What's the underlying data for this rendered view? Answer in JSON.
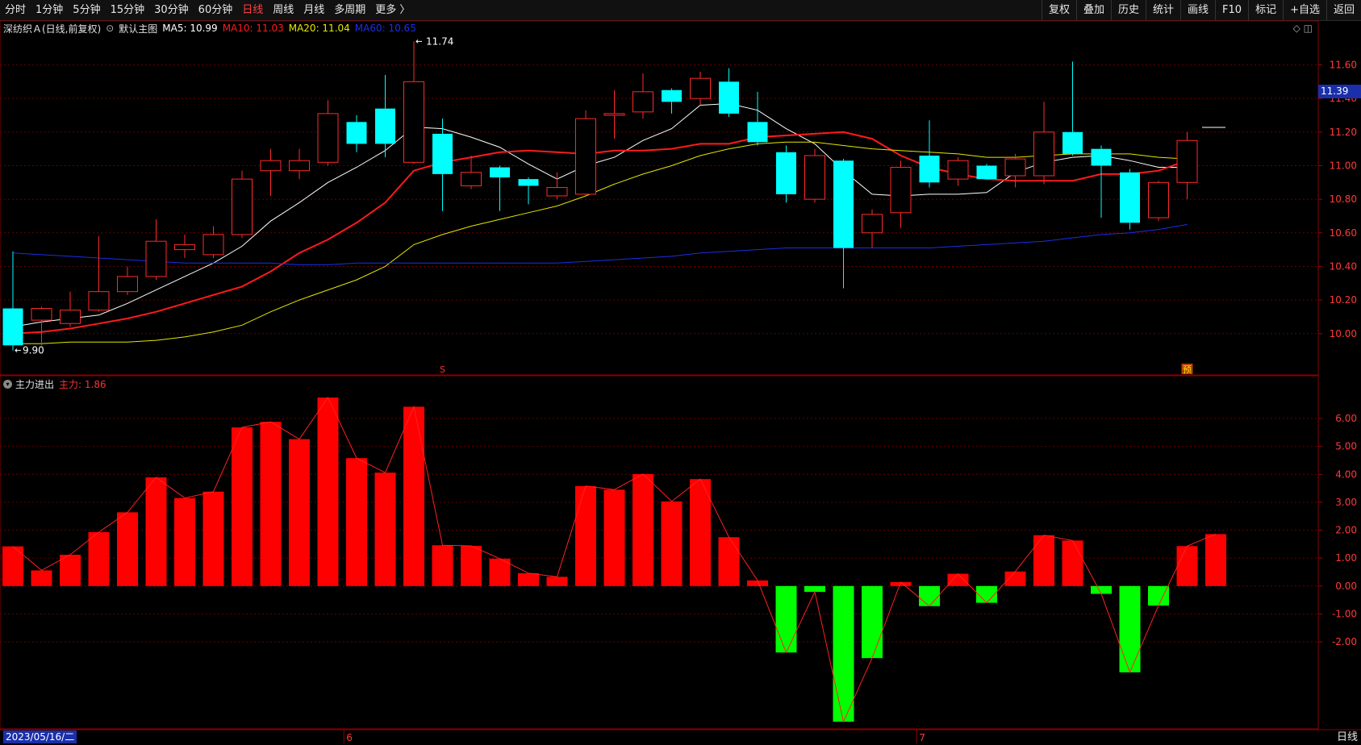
{
  "toolbar": {
    "period_tabs": [
      "分时",
      "1分钟",
      "5分钟",
      "15分钟",
      "30分钟",
      "60分钟",
      "日线",
      "周线",
      "月线",
      "多周期",
      "更多 〉"
    ],
    "active_tab": "日线",
    "right_buttons": [
      "复权",
      "叠加",
      "历史",
      "统计",
      "画线",
      "F10",
      "标记",
      "+自选",
      "返回"
    ]
  },
  "legend": {
    "stock": "深纺织Ａ(日线,前复权)",
    "main_chart": "默认主图",
    "ma5": "MA5: 10.99",
    "ma10": "MA10: 11.03",
    "ma20": "MA20: 11.04",
    "ma60": "MA60: 10.65"
  },
  "indicator": {
    "name": "主力进出",
    "value": "主力: 1.86"
  },
  "current_price_tag": "11.39",
  "date_badge": "2023/05/16/二",
  "period_label": "日线",
  "month_labels": [
    {
      "text": "6",
      "index": 12
    },
    {
      "text": "7",
      "index": 32
    }
  ],
  "markers": [
    {
      "text": "S",
      "index": 15
    },
    {
      "text": "预",
      "index": 41
    }
  ],
  "colors": {
    "up": "#ff2a2a",
    "down": "#00ffff",
    "ma5": "#ffffff",
    "ma10": "#ff1a1a",
    "ma20": "#e6e600",
    "ma60": "#1a2fe6",
    "pos_bar": "#ff0000",
    "neg_bar": "#00ff00",
    "grid": "#6a0000"
  },
  "chart_data": [
    {
      "type": "candlestick",
      "y_ticks": [
        "11.60",
        "11.40",
        "11.20",
        "11.00",
        "10.80",
        "10.60",
        "10.40",
        "10.20",
        "10.00"
      ],
      "ylim": [
        9.85,
        11.78
      ],
      "annotations": [
        {
          "text": "11.74",
          "index": 14
        },
        {
          "text": "9.90",
          "index": 0
        }
      ],
      "candles": [
        {
          "o": 10.15,
          "c": 9.93,
          "h": 10.49,
          "l": 9.9
        },
        {
          "o": 10.08,
          "c": 10.15,
          "h": 10.16,
          "l": 9.93
        },
        {
          "o": 10.06,
          "c": 10.14,
          "h": 10.25,
          "l": 10.04
        },
        {
          "o": 10.14,
          "c": 10.25,
          "h": 10.58,
          "l": 10.13
        },
        {
          "o": 10.25,
          "c": 10.34,
          "h": 10.4,
          "l": 10.23
        },
        {
          "o": 10.34,
          "c": 10.55,
          "h": 10.68,
          "l": 10.32
        },
        {
          "o": 10.5,
          "c": 10.53,
          "h": 10.59,
          "l": 10.45
        },
        {
          "o": 10.47,
          "c": 10.59,
          "h": 10.64,
          "l": 10.45
        },
        {
          "o": 10.59,
          "c": 10.92,
          "h": 10.97,
          "l": 10.57
        },
        {
          "o": 10.97,
          "c": 11.03,
          "h": 11.1,
          "l": 10.82
        },
        {
          "o": 10.97,
          "c": 11.03,
          "h": 11.1,
          "l": 10.92
        },
        {
          "o": 11.02,
          "c": 11.31,
          "h": 11.39,
          "l": 11.0
        },
        {
          "o": 11.26,
          "c": 11.13,
          "h": 11.3,
          "l": 11.08
        },
        {
          "o": 11.34,
          "c": 11.13,
          "h": 11.54,
          "l": 11.05
        },
        {
          "o": 11.02,
          "c": 11.5,
          "h": 11.74,
          "l": 11.01
        },
        {
          "o": 11.19,
          "c": 10.95,
          "h": 11.28,
          "l": 10.73
        },
        {
          "o": 10.88,
          "c": 10.96,
          "h": 11.06,
          "l": 10.86
        },
        {
          "o": 10.99,
          "c": 10.93,
          "h": 11.0,
          "l": 10.73
        },
        {
          "o": 10.92,
          "c": 10.88,
          "h": 10.93,
          "l": 10.77
        },
        {
          "o": 10.82,
          "c": 10.87,
          "h": 10.96,
          "l": 10.8
        },
        {
          "o": 10.83,
          "c": 11.28,
          "h": 11.33,
          "l": 10.82
        },
        {
          "o": 11.3,
          "c": 11.31,
          "h": 11.45,
          "l": 11.16
        },
        {
          "o": 11.32,
          "c": 11.44,
          "h": 11.55,
          "l": 11.28
        },
        {
          "o": 11.45,
          "c": 11.38,
          "h": 11.46,
          "l": 11.31
        },
        {
          "o": 11.4,
          "c": 11.52,
          "h": 11.56,
          "l": 11.36
        },
        {
          "o": 11.5,
          "c": 11.31,
          "h": 11.58,
          "l": 11.29
        },
        {
          "o": 11.26,
          "c": 11.14,
          "h": 11.44,
          "l": 11.12
        },
        {
          "o": 11.08,
          "c": 10.83,
          "h": 11.12,
          "l": 10.78
        },
        {
          "o": 10.8,
          "c": 11.06,
          "h": 11.1,
          "l": 10.78
        },
        {
          "o": 11.03,
          "c": 10.51,
          "h": 11.04,
          "l": 10.27
        },
        {
          "o": 10.6,
          "c": 10.71,
          "h": 10.74,
          "l": 10.51
        },
        {
          "o": 10.72,
          "c": 10.99,
          "h": 11.03,
          "l": 10.63
        },
        {
          "o": 11.06,
          "c": 10.9,
          "h": 11.27,
          "l": 10.87
        },
        {
          "o": 10.92,
          "c": 11.03,
          "h": 11.05,
          "l": 10.88
        },
        {
          "o": 11.0,
          "c": 10.92,
          "h": 11.01,
          "l": 10.92
        },
        {
          "o": 10.94,
          "c": 11.04,
          "h": 11.07,
          "l": 10.87
        },
        {
          "o": 10.94,
          "c": 11.2,
          "h": 11.38,
          "l": 10.89
        },
        {
          "o": 11.2,
          "c": 11.07,
          "h": 11.62,
          "l": 11.06
        },
        {
          "o": 11.1,
          "c": 11.0,
          "h": 11.12,
          "l": 10.69
        },
        {
          "o": 10.96,
          "c": 10.66,
          "h": 10.98,
          "l": 10.62
        },
        {
          "o": 10.69,
          "c": 10.9,
          "h": 10.91,
          "l": 10.67
        },
        {
          "o": 10.9,
          "c": 11.15,
          "h": 11.2,
          "l": 10.8
        }
      ],
      "series": [
        {
          "name": "MA5",
          "values": [
            10.04,
            10.07,
            10.09,
            10.11,
            10.18,
            10.26,
            10.34,
            10.42,
            10.52,
            10.67,
            10.78,
            10.9,
            10.99,
            11.09,
            11.23,
            11.22,
            11.17,
            11.11,
            11.01,
            10.92,
            11.0,
            11.05,
            11.15,
            11.22,
            11.36,
            11.37,
            11.33,
            11.22,
            11.13,
            10.97,
            10.83,
            10.82,
            10.83,
            10.83,
            10.84,
            10.96,
            11.02,
            11.05,
            11.06,
            11.03,
            10.99,
            10.99
          ]
        },
        {
          "name": "MA10",
          "values": [
            10.0,
            10.01,
            10.03,
            10.06,
            10.09,
            10.13,
            10.18,
            10.23,
            10.28,
            10.37,
            10.48,
            10.56,
            10.66,
            10.78,
            10.97,
            11.02,
            11.05,
            11.08,
            11.09,
            11.08,
            11.07,
            11.09,
            11.09,
            11.1,
            11.13,
            11.13,
            11.17,
            11.18,
            11.19,
            11.2,
            11.16,
            11.06,
            10.99,
            10.95,
            10.92,
            10.91,
            10.91,
            10.91,
            10.95,
            10.95,
            10.97,
            11.03
          ]
        },
        {
          "name": "MA20",
          "values": [
            9.94,
            9.94,
            9.95,
            9.95,
            9.95,
            9.96,
            9.98,
            10.01,
            10.05,
            10.13,
            10.2,
            10.26,
            10.32,
            10.4,
            10.53,
            10.59,
            10.64,
            10.68,
            10.72,
            10.76,
            10.82,
            10.89,
            10.95,
            11.0,
            11.06,
            11.1,
            11.13,
            11.14,
            11.14,
            11.12,
            11.1,
            11.09,
            11.08,
            11.07,
            11.05,
            11.05,
            11.06,
            11.07,
            11.07,
            11.07,
            11.05,
            11.04
          ]
        },
        {
          "name": "MA60",
          "values": [
            10.48,
            10.47,
            10.46,
            10.45,
            10.44,
            10.43,
            10.42,
            10.42,
            10.42,
            10.42,
            10.41,
            10.41,
            10.42,
            10.42,
            10.42,
            10.42,
            10.42,
            10.42,
            10.42,
            10.42,
            10.43,
            10.44,
            10.45,
            10.46,
            10.48,
            10.49,
            10.5,
            10.51,
            10.51,
            10.51,
            10.51,
            10.51,
            10.51,
            10.52,
            10.53,
            10.54,
            10.55,
            10.57,
            10.59,
            10.6,
            10.62,
            10.65
          ]
        }
      ]
    },
    {
      "type": "bar",
      "name": "主力",
      "y_ticks": [
        "6.00",
        "5.00",
        "4.00",
        "3.00",
        "2.00",
        "1.00",
        "0.00",
        "-1.00",
        "-2.00"
      ],
      "ylim": [
        -5.0,
        7.3
      ],
      "values": [
        1.42,
        0.56,
        1.12,
        1.93,
        2.64,
        3.89,
        3.15,
        3.38,
        5.68,
        5.88,
        5.26,
        6.75,
        4.58,
        4.06,
        6.42,
        1.46,
        1.44,
        0.98,
        0.46,
        0.33,
        3.58,
        3.45,
        4.01,
        3.03,
        3.83,
        1.75,
        0.2,
        -2.38,
        -0.21,
        -4.86,
        -2.58,
        0.14,
        -0.72,
        0.44,
        -0.6,
        0.52,
        1.82,
        1.63,
        -0.28,
        -3.09,
        -0.7,
        1.43,
        1.86
      ]
    }
  ]
}
